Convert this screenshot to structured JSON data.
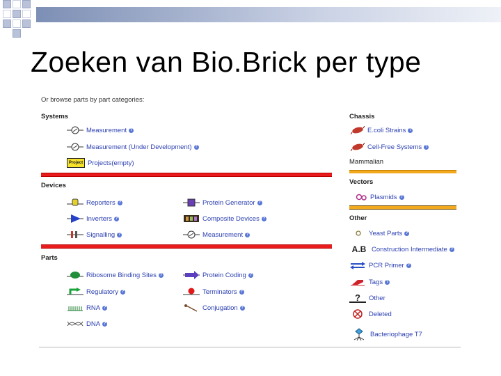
{
  "slide_title": "Zoeken van Bio.Brick per type",
  "panel": {
    "intro": "Or browse parts by part categories:",
    "sections": {
      "systems": "Systems",
      "devices": "Devices",
      "parts": "Parts",
      "chassis": "Chassis",
      "mammalian": "Mammalian",
      "vectors": "Vectors",
      "other": "Other"
    },
    "systems_items": [
      {
        "label": "Measurement",
        "icon": "measurement-icon"
      },
      {
        "label": "Measurement (Under Development)",
        "icon": "measurement-icon"
      },
      {
        "label": "Projects(empty)",
        "icon": "project-icon",
        "icon_text": "Project"
      }
    ],
    "devices_left": [
      {
        "label": "Reporters",
        "icon": "reporter-icon"
      },
      {
        "label": "Inverters",
        "icon": "inverter-icon"
      },
      {
        "label": "Signalling",
        "icon": "signalling-icon"
      }
    ],
    "devices_right": [
      {
        "label": "Protein Generator",
        "icon": "protein-generator-icon"
      },
      {
        "label": "Composite Devices",
        "icon": "composite-device-icon"
      },
      {
        "label": "Measurement",
        "icon": "measurement-icon"
      }
    ],
    "parts_left": [
      {
        "label": "Ribosome Binding Sites",
        "icon": "rbs-icon"
      },
      {
        "label": "Regulatory",
        "icon": "regulatory-icon"
      },
      {
        "label": "RNA",
        "icon": "rna-icon"
      },
      {
        "label": "DNA",
        "icon": "dna-icon"
      }
    ],
    "parts_right": [
      {
        "label": "Protein Coding",
        "icon": "protein-coding-icon"
      },
      {
        "label": "Terminators",
        "icon": "terminator-icon"
      },
      {
        "label": "Conjugation",
        "icon": "conjugation-icon"
      }
    ],
    "chassis_items": [
      {
        "label": "E.coli Strains",
        "icon": "ecoli-icon"
      },
      {
        "label": "Cell-Free Systems",
        "icon": "cell-free-icon"
      }
    ],
    "vectors_items": [
      {
        "label": "Plasmids",
        "icon": "plasmid-icon"
      }
    ],
    "other_items": [
      {
        "label": "Yeast Parts",
        "icon": "yeast-icon"
      },
      {
        "label": "Construction Intermediate",
        "icon": "construction-intermediate-icon",
        "icon_text": "A.B"
      },
      {
        "label": "PCR Primer",
        "icon": "pcr-primer-icon"
      },
      {
        "label": "Tags",
        "icon": "tag-icon"
      },
      {
        "label": "Other",
        "icon": "question-icon",
        "icon_text": "?"
      },
      {
        "label": "Deleted",
        "icon": "deleted-icon"
      },
      {
        "label": "Bacteriophage T7",
        "icon": "bacteriophage-icon"
      }
    ],
    "help_mark": "?"
  },
  "colors": {
    "link": "#2b3fb0",
    "red_bar": "#e81c1c",
    "orange_bar": "#f3a91e",
    "help": "#5a77d6"
  }
}
